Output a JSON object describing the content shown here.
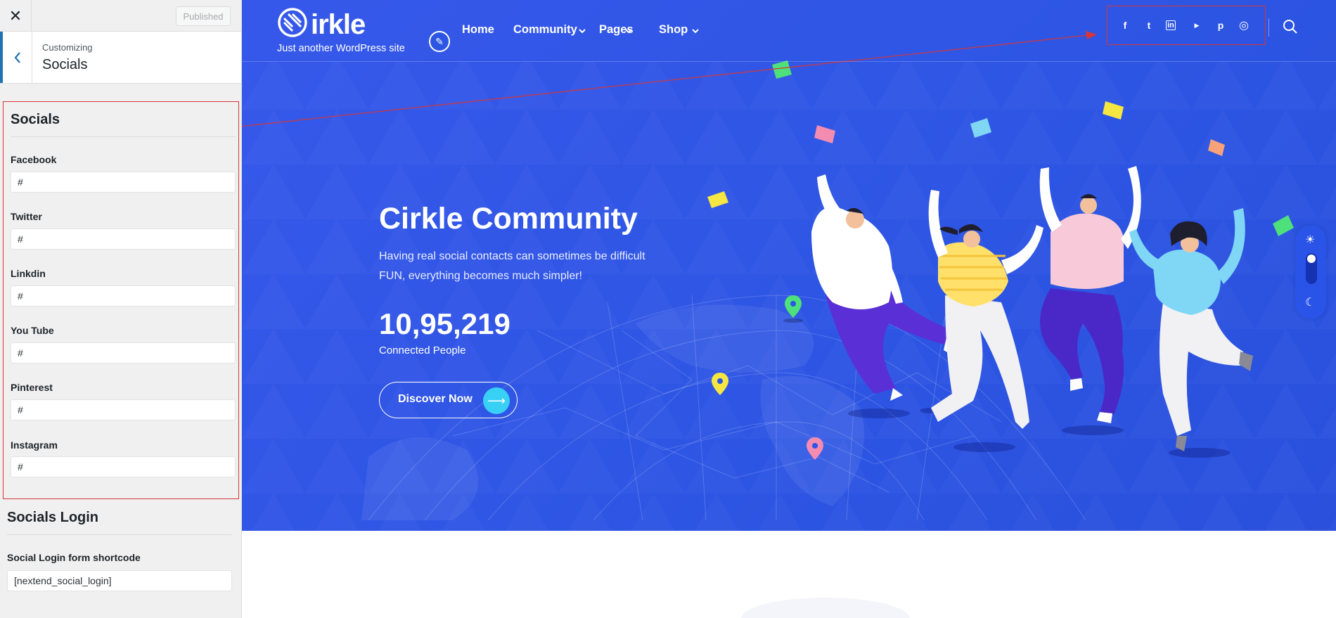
{
  "customizer": {
    "close_label": "✕",
    "publish_label": "Published",
    "breadcrumb": "Customizing",
    "section_title": "Socials",
    "socials_heading": "Socials",
    "fields": [
      {
        "label": "Facebook",
        "value": "#"
      },
      {
        "label": "Twitter",
        "value": "#"
      },
      {
        "label": "Linkdin",
        "value": "#"
      },
      {
        "label": "You Tube",
        "value": "#"
      },
      {
        "label": "Pinterest",
        "value": "#"
      },
      {
        "label": "Instagram",
        "value": "#"
      }
    ],
    "login_heading": "Socials Login",
    "login_field": {
      "label": "Social Login form shortcode",
      "value": "[nextend_social_login]"
    }
  },
  "site": {
    "logo_text": "irkle",
    "tagline": "Just another WordPress site",
    "nav": [
      {
        "label": "Home",
        "has_dropdown": false
      },
      {
        "label": "Community",
        "has_dropdown": true
      },
      {
        "label": "Pages",
        "has_dropdown": true
      },
      {
        "label": "Shop",
        "has_dropdown": true
      }
    ],
    "social_icons": [
      "facebook-icon",
      "twitter-icon",
      "linkedin-icon",
      "youtube-icon",
      "pinterest-icon",
      "instagram-icon"
    ],
    "social_glyphs": {
      "facebook": "f",
      "twitter": "t",
      "linkedin": "in",
      "youtube": "▶",
      "pinterest": "p",
      "instagram": "◎"
    }
  },
  "hero": {
    "title": "Cirkle Community",
    "line1": "Having real social contacts can sometimes be difficult",
    "line2": "FUN, everything becomes much simpler!",
    "stat_value": "10,95,219",
    "stat_label": "Connected People",
    "cta_label": "Discover Now"
  },
  "colors": {
    "hero_bg": "#2d55e3",
    "accent_cyan": "#38d0f5",
    "annotation_red": "#d63638",
    "wp_blue": "#2271b1"
  }
}
